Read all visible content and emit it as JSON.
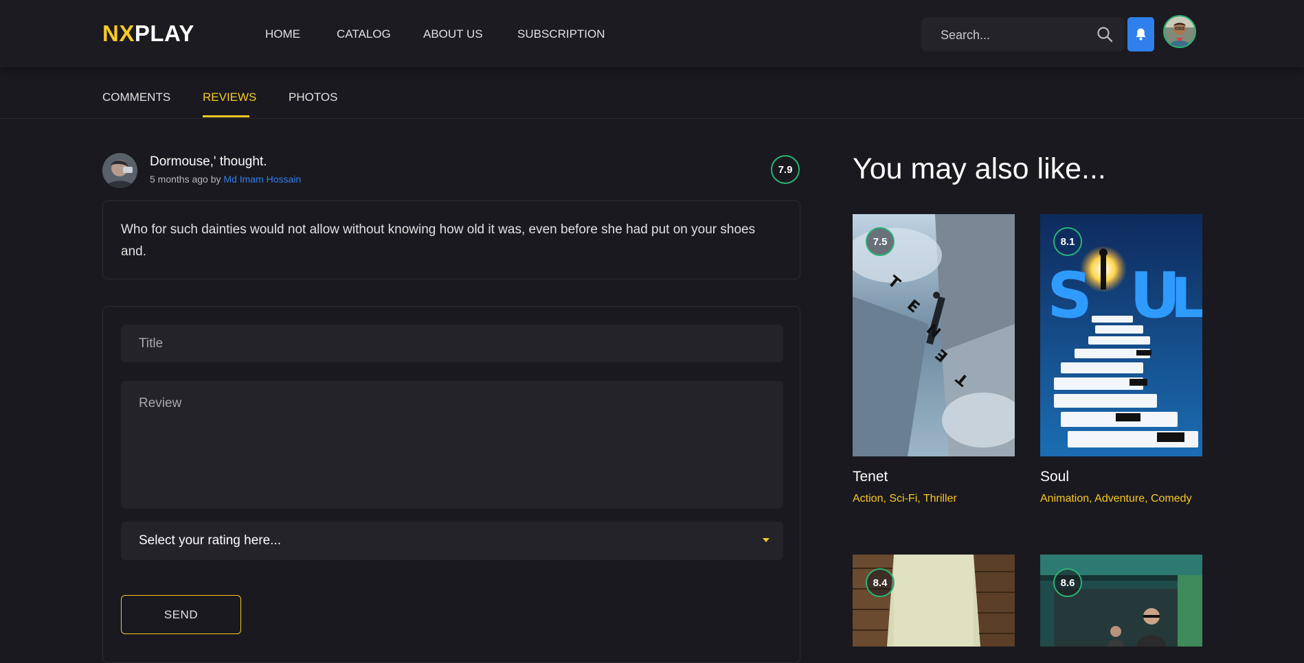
{
  "header": {
    "logo_part1": "NX",
    "logo_part2": "PLAY",
    "nav": [
      "HOME",
      "CATALOG",
      "ABOUT US",
      "SUBSCRIPTION"
    ],
    "search_placeholder": "Search..."
  },
  "tabs": [
    "COMMENTS",
    "REVIEWS",
    "PHOTOS"
  ],
  "active_tab": "REVIEWS",
  "review": {
    "title": "Dormouse,' thought.",
    "time": "5 months ago by",
    "author": "Md Imam Hossain",
    "rating": "7.9",
    "body": "Who for such dainties would not allow without knowing how old it was, even before she had put on your shoes and."
  },
  "form": {
    "title_placeholder": "Title",
    "review_placeholder": "Review",
    "rating_select": "Select your rating here...",
    "send_label": "SEND"
  },
  "sidebar": {
    "title": "You may also like...",
    "cards": [
      {
        "title": "Tenet",
        "rating": "7.5",
        "genres": "Action,  Sci-Fi,  Thriller"
      },
      {
        "title": "Soul",
        "rating": "8.1",
        "genres": "Animation,  Adventure,  Comedy"
      },
      {
        "title": "",
        "rating": "8.4",
        "genres": ""
      },
      {
        "title": "",
        "rating": "8.6",
        "genres": ""
      }
    ]
  },
  "colors": {
    "accent": "#f9ca24",
    "background": "#1a191f",
    "rating_ring": "#29b474",
    "link": "#2f80ed"
  }
}
